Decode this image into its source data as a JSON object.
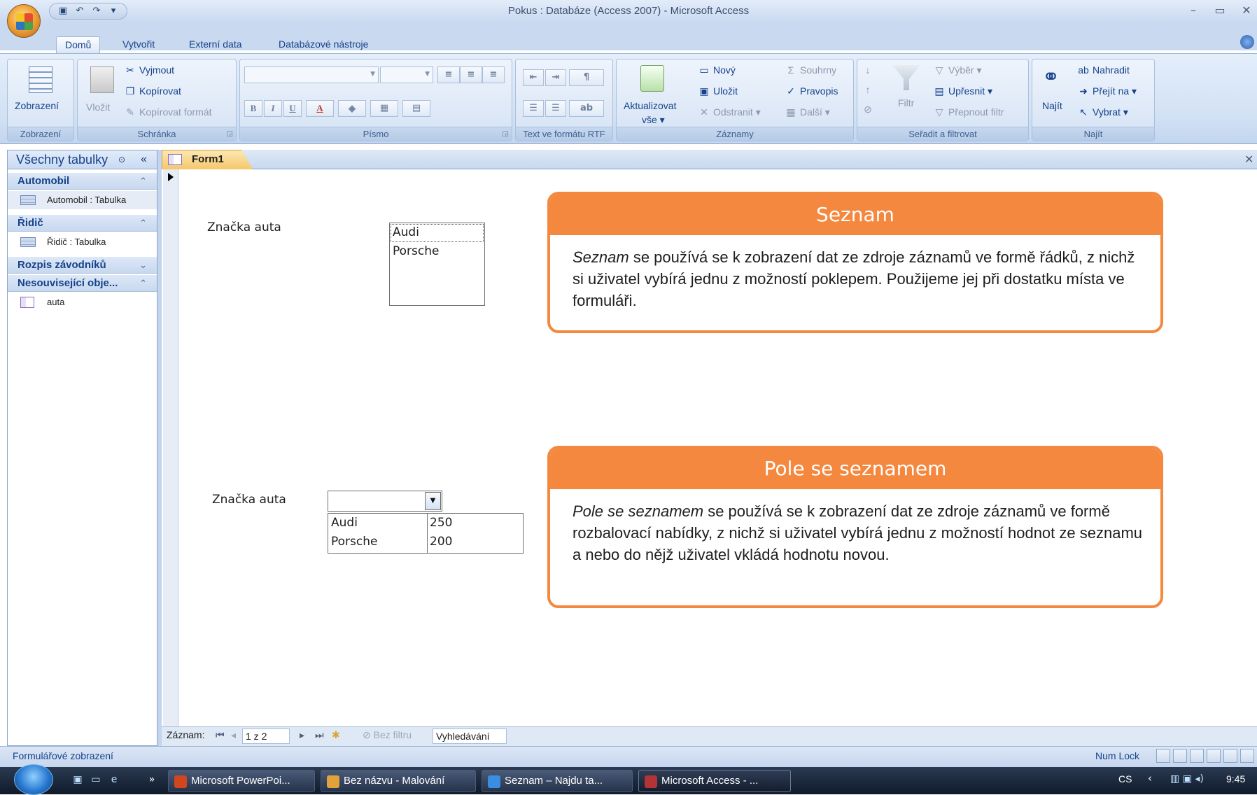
{
  "window": {
    "title": "Pokus : Databáze (Access 2007) - Microsoft Access",
    "minimize": "–",
    "restore": "▭",
    "close": "✕"
  },
  "qat": {
    "save_icon": "save-icon",
    "undo_icon": "undo-icon",
    "redo_icon": "redo-icon"
  },
  "ribbon_tabs": [
    "Domů",
    "Vytvořit",
    "Externí data",
    "Databázové nástroje"
  ],
  "ribbon": {
    "zobrazeni": {
      "button": "Zobrazení",
      "group": "Zobrazení"
    },
    "schranka": {
      "paste": "Vložit",
      "cut": "Vyjmout",
      "copy": "Kopírovat",
      "format_painter": "Kopírovat formát",
      "group": "Schránka"
    },
    "pismo": {
      "bold": "B",
      "italic": "I",
      "underline": "U",
      "font_color": "A",
      "group": "Písmo"
    },
    "rtf": {
      "group": "Text ve formátu RTF"
    },
    "zaznamy": {
      "refresh_line1": "Aktualizovat",
      "refresh_line2": "vše ▾",
      "new": "Nový",
      "save": "Uložit",
      "delete": "Odstranit ▾",
      "totals": "Souhrny",
      "spelling": "Pravopis",
      "more": "Další ▾",
      "group": "Záznamy"
    },
    "filtr": {
      "filter": "Filtr",
      "selection": "Výběr ▾",
      "advanced": "Upřesnit ▾",
      "toggle": "Přepnout filtr",
      "group": "Seřadit a filtrovat"
    },
    "najit": {
      "find": "Najít",
      "replace": "Nahradit",
      "goto": "Přejít na ▾",
      "select": "Vybrat ▾",
      "group": "Najít"
    }
  },
  "nav": {
    "header": "Všechny tabulky",
    "sections": [
      {
        "title": "Automobil",
        "items": [
          "Automobil : Tabulka"
        ]
      },
      {
        "title": "Řidič",
        "items": [
          "Řidič : Tabulka"
        ]
      },
      {
        "title": "Rozpis závodníků",
        "items": []
      },
      {
        "title": "Nesouvisející obje...",
        "items": [
          "auta"
        ]
      }
    ]
  },
  "document": {
    "tab": "Form1"
  },
  "form": {
    "listbox_label": "Značka auta",
    "listbox_items": [
      "Audi",
      "Porsche"
    ],
    "combo_label": "Značka auta",
    "combo_rows": [
      {
        "name": "Audi",
        "value": "250"
      },
      {
        "name": "Porsche",
        "value": "200"
      }
    ]
  },
  "callouts": {
    "seznam": {
      "title": "Seznam",
      "em": "Seznam",
      "text": " se používá se k zobrazení dat ze zdroje záznamů ve formě řádků, z nichž si uživatel vybírá jednu z možností poklepem. Použijeme jej při dostatku místa ve formuláři."
    },
    "pole": {
      "title": "Pole se seznamem",
      "em": "Pole se seznamem",
      "text": " se používá se k zobrazení dat ze zdroje záznamů ve formě rozbalovací nabídky, z nichž si uživatel vybírá jednu z možností hodnot ze seznamu a nebo do nějž uživatel vkládá hodnotu novou."
    }
  },
  "recnav": {
    "label": "Záznam:",
    "position": "1 z 2",
    "filter": "Bez filtru",
    "search": "Vyhledávání"
  },
  "status": {
    "left": "Formulářové zobrazení",
    "numlock": "Num Lock"
  },
  "taskbar": {
    "buttons": [
      "Microsoft PowerPoi...",
      "Bez názvu - Malování",
      "Seznam – Najdu ta...",
      "Microsoft Access - ..."
    ],
    "lang": "CS",
    "time": "9:45"
  },
  "colors": {
    "accent": "#f5883f",
    "ribbon_text": "#15428b"
  }
}
